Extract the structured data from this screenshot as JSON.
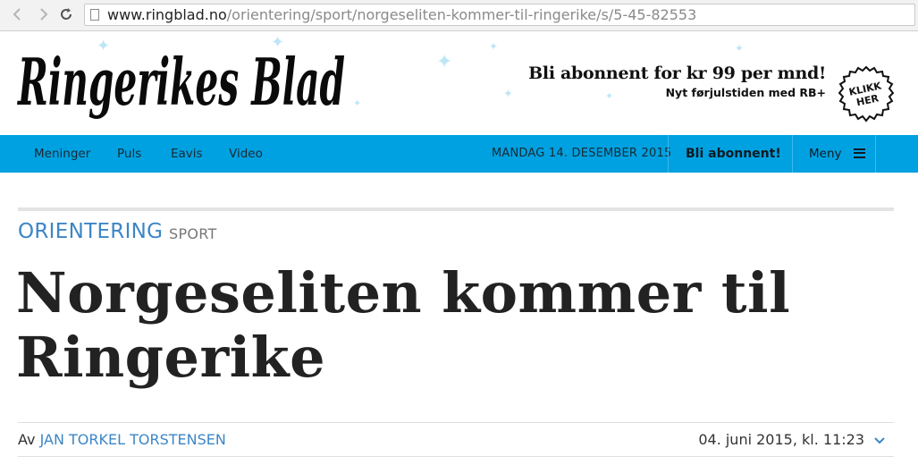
{
  "browser": {
    "url_host": "www.ringblad.no",
    "url_path": "/orientering/sport/norgeseliten-kommer-til-ringerike/s/5-45-82553",
    "back_icon": "chevron-left-icon",
    "forward_icon": "chevron-right-icon",
    "reload_icon": "reload-icon"
  },
  "masthead": {
    "logo_text": "Ringerikes Blad",
    "promo_line1": "Bli abonnent for kr 99 per mnd!",
    "promo_line2": "Nyt førjulstiden med RB+",
    "badge_line1": "KLIKK",
    "badge_line2": "HER"
  },
  "nav": {
    "items": [
      "Meninger",
      "Puls",
      "Eavis",
      "Video"
    ],
    "date": "MANDAG 14. DESEMBER 2015",
    "subscribe": "Bli abonnent!",
    "menu": "Meny",
    "color": "#00a1e1"
  },
  "article": {
    "kicker": "ORIENTERING",
    "section": "SPORT",
    "headline_line1": "Norgeseliten kommer til",
    "headline_line2": "Ringerike",
    "byline_prefix": "Av",
    "byline_name": "JAN TORKEL TORSTENSEN",
    "published": "04. juni 2015, kl. 11:23"
  },
  "colors": {
    "accent": "#3d86c6",
    "headline": "#222222"
  }
}
